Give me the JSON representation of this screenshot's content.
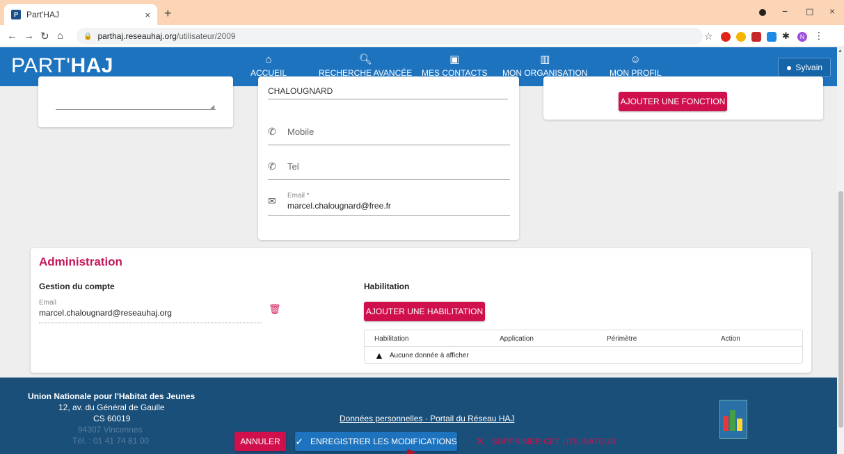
{
  "browser": {
    "tab_title": "Part'HAJ",
    "tab_close": "×",
    "new_tab": "+",
    "url_domain": "parthaj.reseauhaj.org",
    "url_path": "/utilisateur/2009",
    "minimize": "−",
    "maximize": "◻",
    "close": "×"
  },
  "header": {
    "logo_part": "PART'",
    "logo_haj": "HAJ",
    "nav": [
      {
        "label": "Accueil",
        "icon": "home-icon"
      },
      {
        "label": "Recherche avancée",
        "icon": "search-icon"
      },
      {
        "label": "Mes contacts",
        "icon": "contacts-icon"
      },
      {
        "label": "Mon organisation",
        "icon": "building-icon"
      },
      {
        "label": "Mon profil",
        "icon": "person-icon"
      }
    ],
    "user": "Sylvain"
  },
  "contact": {
    "lastname_value": "CHALOUGNARD",
    "mobile_placeholder": "Mobile",
    "tel_placeholder": "Tel",
    "email_label": "Email *",
    "email_value": "marcel.chalougnard@free.fr"
  },
  "fonction": {
    "add_label": "Ajouter une fonction"
  },
  "administration": {
    "title": "Administration",
    "account_heading": "Gestion du compte",
    "email_label": "Email",
    "email_value": "marcel.chalougnard@reseauhaj.org",
    "habilitation_heading": "Habilitation",
    "add_habilitation": "Ajouter une habilitation",
    "table": {
      "columns": [
        "Habilitation",
        "Application",
        "Périmètre",
        "Action"
      ],
      "empty": "Aucune donnée à afficher"
    }
  },
  "footer": {
    "org": "Union Nationale pour l'Habitat des Jeunes",
    "address1": "12, av. du Général de Gaulle",
    "address2": "CS 60019",
    "address3": "94307 Vincennes",
    "phone": "Tél. : 01 41 74 81 00",
    "link_personal": "Données personnelles",
    "link_sep": " · ",
    "link_portal": "Portail du Réseau HAJ"
  },
  "actions": {
    "cancel": "Annuler",
    "save": "Enregistrer les modifications",
    "delete": "Supprimer cet utilisateur"
  },
  "colors": {
    "primary": "#1e73be",
    "accent": "#d0104c",
    "footer": "#1a4f7a"
  }
}
